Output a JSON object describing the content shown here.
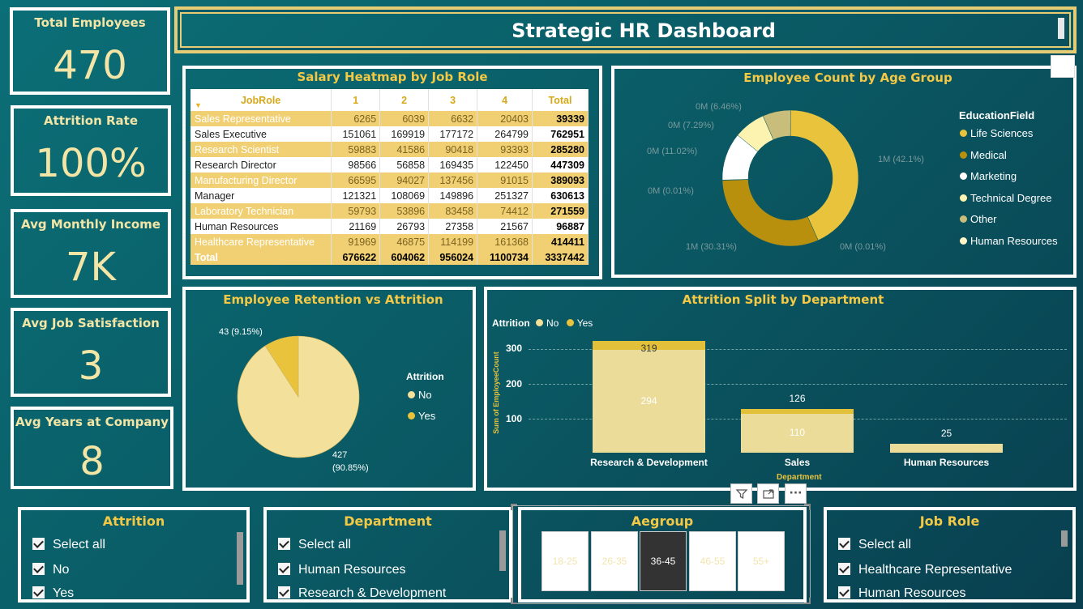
{
  "header": {
    "title": "Strategic HR Dashboard"
  },
  "kpis": [
    {
      "title": "Total Employees",
      "value": "470"
    },
    {
      "title": "Attrition Rate",
      "value": "100%"
    },
    {
      "title": "Avg Monthly Income",
      "value": "7K"
    },
    {
      "title": "Avg Job Satisfaction",
      "value": "3"
    },
    {
      "title": "Avg Years at Company",
      "value": "8"
    }
  ],
  "heatmap": {
    "title": "Salary Heatmap by Job Role",
    "columns": [
      "JobRole",
      "1",
      "2",
      "3",
      "4",
      "Total"
    ],
    "rows": [
      {
        "role": "Sales Representative",
        "v": [
          "6265",
          "6039",
          "6632",
          "20403"
        ],
        "total": "39339"
      },
      {
        "role": "Sales Executive",
        "v": [
          "151061",
          "169919",
          "177172",
          "264799"
        ],
        "total": "762951"
      },
      {
        "role": "Research Scientist",
        "v": [
          "59883",
          "41586",
          "90418",
          "93393"
        ],
        "total": "285280"
      },
      {
        "role": "Research Director",
        "v": [
          "98566",
          "56858",
          "169435",
          "122450"
        ],
        "total": "447309"
      },
      {
        "role": "Manufacturing Director",
        "v": [
          "66595",
          "94027",
          "137456",
          "91015"
        ],
        "total": "389093"
      },
      {
        "role": "Manager",
        "v": [
          "121321",
          "108069",
          "149896",
          "251327"
        ],
        "total": "630613"
      },
      {
        "role": "Laboratory Technician",
        "v": [
          "59793",
          "53896",
          "83458",
          "74412"
        ],
        "total": "271559"
      },
      {
        "role": "Human Resources",
        "v": [
          "21169",
          "26793",
          "27358",
          "21567"
        ],
        "total": "96887"
      },
      {
        "role": "Healthcare Representative",
        "v": [
          "91969",
          "46875",
          "114199",
          "161368"
        ],
        "total": "414411"
      }
    ],
    "total_row": {
      "role": "Total",
      "v": [
        "676622",
        "604062",
        "956024",
        "1100734"
      ],
      "total": "3337442"
    }
  },
  "age_chart": {
    "title": "Employee Count by Age Group",
    "legend_title": "EducationField",
    "legend": [
      {
        "name": "Life Sciences",
        "color": "#e9c33b"
      },
      {
        "name": "Medical",
        "color": "#b8900e"
      },
      {
        "name": "Marketing",
        "color": "#ffffff"
      },
      {
        "name": "Technical Degree",
        "color": "#fdf3b0"
      },
      {
        "name": "Other",
        "color": "#c8bd7a"
      },
      {
        "name": "Human Resources",
        "color": "#fff7c8"
      }
    ],
    "labels": {
      "life_sciences": "1M (42.1%)",
      "medical": "1M (30.31%)",
      "marketing_small": "0M (0.01%)",
      "hr_small": "0M (0.01%)",
      "marketing": "0M (11.02%)",
      "technical": "0M (7.29%)",
      "other": "0M (6.46%)"
    }
  },
  "retention_chart": {
    "title": "Employee Retention vs Attrition",
    "legend_title": "Attrition",
    "legend": [
      {
        "name": "No",
        "color": "#f3e09a"
      },
      {
        "name": "Yes",
        "color": "#e9c33b"
      }
    ],
    "label_yes": "43 (9.15%)",
    "label_no_1": "427",
    "label_no_2": "(90.85%)"
  },
  "dept_chart": {
    "title": "Attrition Split by Department",
    "legend_title": "Attrition",
    "legend_no": "No",
    "legend_yes": "Yes",
    "ylabel": "Sum of EmployeeCount",
    "xlabel": "Department",
    "ticks": [
      "300",
      "200",
      "100"
    ]
  },
  "chart_data": [
    {
      "type": "pie",
      "title": "Employee Count by Age Group",
      "legend_title": "EducationField",
      "categories": [
        "Life Sciences",
        "Medical",
        "Human Resources",
        "Marketing",
        "Technical Degree",
        "Other"
      ],
      "values": [
        42.1,
        30.31,
        0.01,
        11.02,
        7.29,
        6.46
      ],
      "donut": true
    },
    {
      "type": "pie",
      "title": "Employee Retention vs Attrition",
      "categories": [
        "No",
        "Yes"
      ],
      "values": [
        427,
        43
      ]
    },
    {
      "type": "bar",
      "title": "Attrition Split by Department",
      "categories": [
        "Research & Development",
        "Sales",
        "Human Resources"
      ],
      "series": [
        {
          "name": "No",
          "values": [
            294,
            110,
            25
          ]
        },
        {
          "name": "Yes",
          "values": [
            25,
            16,
            0
          ]
        }
      ],
      "totals": [
        "319",
        "126",
        "25"
      ],
      "inner_labels": [
        "294",
        "110"
      ],
      "ylabel": "Sum of EmployeeCount",
      "xlabel": "Department",
      "ylim": [
        0,
        320
      ]
    }
  ],
  "slicers": {
    "attrition": {
      "title": "Attrition",
      "items": [
        "Select all",
        "No",
        "Yes"
      ]
    },
    "department": {
      "title": "Department",
      "items": [
        "Select all",
        "Human Resources",
        "Research & Development"
      ]
    },
    "agegroup": {
      "title": "Aegroup",
      "items": [
        "18-25",
        "26-35",
        "36-45",
        "46-55",
        "55+"
      ],
      "selected": "36-45"
    },
    "jobrole": {
      "title": "Job Role",
      "items": [
        "Select all",
        "Healthcare Representative",
        "Human Resources"
      ]
    }
  },
  "toolbar": {
    "filter_icon": "filter-icon",
    "focus_icon": "focus-mode-icon",
    "more": "···"
  }
}
